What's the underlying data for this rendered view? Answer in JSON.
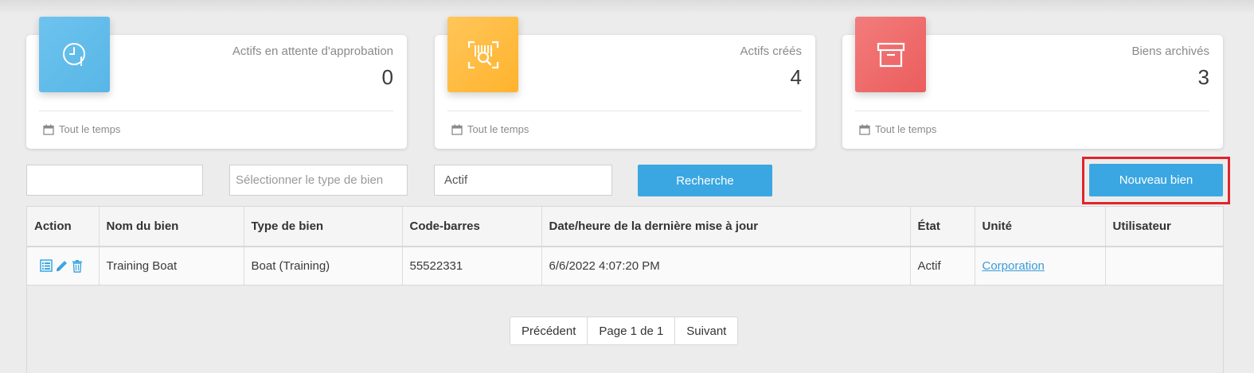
{
  "stats": [
    {
      "label": "Actifs en attente d'approbation",
      "value": "0",
      "footer": "Tout le temps",
      "icon": "clock-icon",
      "color": "#5db8e8"
    },
    {
      "label": "Actifs créés",
      "value": "4",
      "footer": "Tout le temps",
      "icon": "barcode-scan-icon",
      "color": "#ffba3b"
    },
    {
      "label": "Biens archivés",
      "value": "3",
      "footer": "Tout le temps",
      "icon": "archive-box-icon",
      "color": "#ee6565"
    }
  ],
  "filters": {
    "search_value": "",
    "type_placeholder": "Sélectionner le type de bien",
    "status_value": "Actif",
    "search_button": "Recherche",
    "new_button": "Nouveau bien"
  },
  "table": {
    "headers": {
      "action": "Action",
      "name": "Nom du bien",
      "type": "Type de bien",
      "barcode": "Code-barres",
      "updated": "Date/heure de la dernière mise à jour",
      "state": "État",
      "unit": "Unité",
      "user": "Utilisateur"
    },
    "rows": [
      {
        "name": "Training Boat",
        "type": "Boat (Training)",
        "barcode": "55522331",
        "updated": "6/6/2022 4:07:20 PM",
        "state": "Actif",
        "unit": "Corporation",
        "user": ""
      }
    ]
  },
  "pagination": {
    "previous": "Précédent",
    "page": "Page 1 de 1",
    "next": "Suivant"
  }
}
